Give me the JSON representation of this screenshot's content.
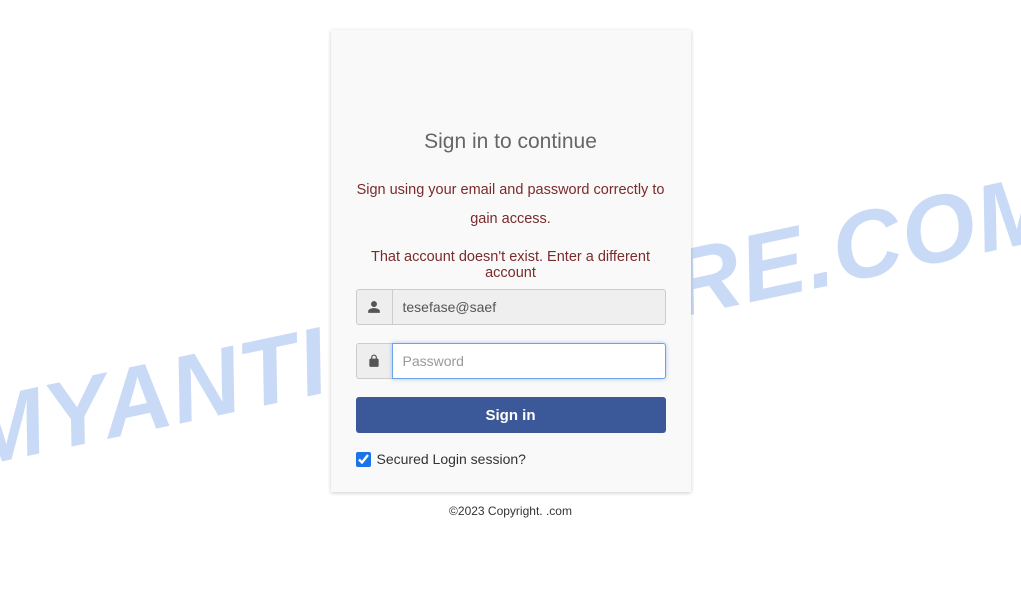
{
  "watermark": "MYANTISPYWARE.COM",
  "card": {
    "title": "Sign in to continue",
    "instruction": "Sign using your email and password correctly to gain access.",
    "error": "That account doesn't exist. Enter a different account",
    "email_value": "tesefase@saef",
    "password_placeholder": "Password",
    "signin_label": "Sign in",
    "checkbox_label": "Secured Login session?",
    "checkbox_checked": true
  },
  "footer": {
    "copyright": "©2023 Copyright. .com"
  }
}
